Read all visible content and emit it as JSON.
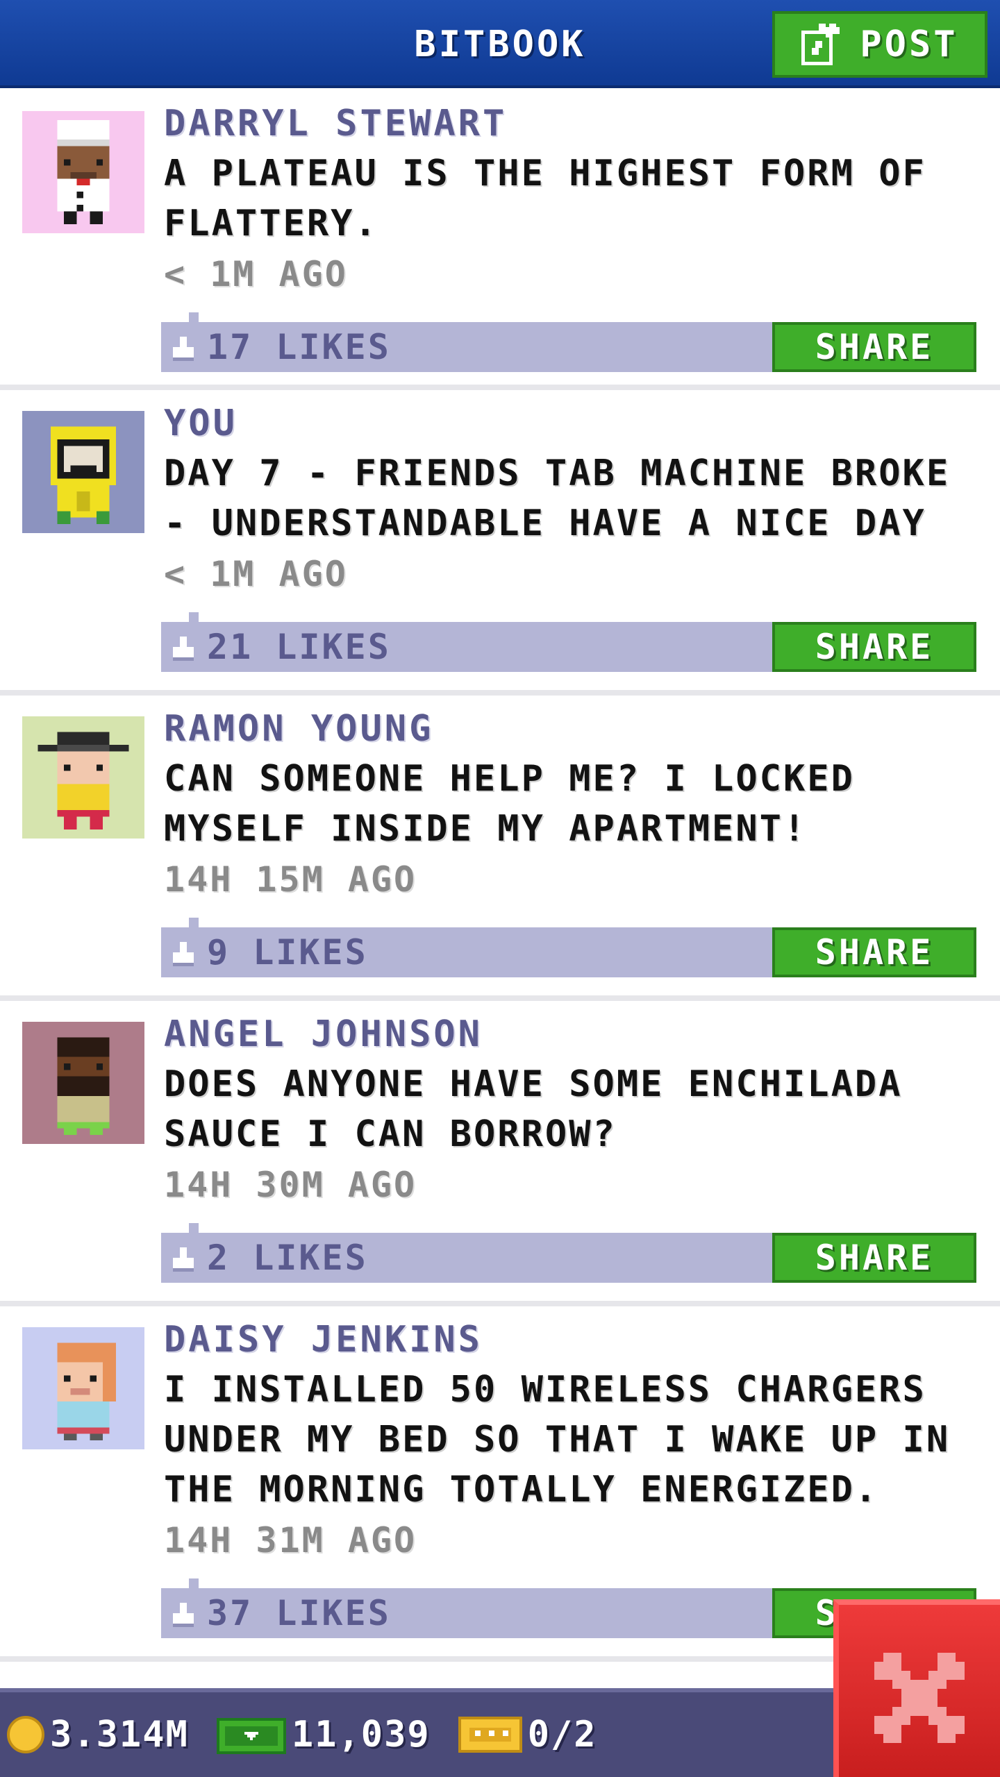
{
  "header": {
    "title": "BITBOOK",
    "post_label": "POST",
    "post_icon": "edit-icon"
  },
  "posts": [
    {
      "author": "DARRYL STEWART",
      "message": "A PLATEAU IS THE HIGHEST FORM OF FLATTERY.",
      "time": "< 1M AGO",
      "likes": "17 LIKES",
      "share_label": "SHARE",
      "avatar_bg": "#f8c8ef",
      "avatar": "chef-avatar"
    },
    {
      "author": "YOU",
      "message": "DAY 7 - FRIENDS TAB MACHINE BROKE - UNDERSTANDABLE HAVE A NICE DAY",
      "time": "< 1M AGO",
      "likes": "21 LIKES",
      "share_label": "SHARE",
      "avatar_bg": "#8c93bf",
      "avatar": "hazmat-avatar"
    },
    {
      "author": "RAMON YOUNG",
      "message": "CAN SOMEONE HELP ME? I LOCKED MYSELF INSIDE MY APARTMENT!",
      "time": "14H 15M AGO",
      "likes": "9 LIKES",
      "share_label": "SHARE",
      "avatar_bg": "#d6e4ae",
      "avatar": "bowler-hat-avatar"
    },
    {
      "author": "ANGEL JOHNSON",
      "message": "DOES ANYONE HAVE SOME ENCHILADA SAUCE I CAN BORROW?",
      "time": "14H 30M AGO",
      "likes": "2 LIKES",
      "share_label": "SHARE",
      "avatar_bg": "#ae7c8a",
      "avatar": "bearded-avatar"
    },
    {
      "author": "DAISY JENKINS",
      "message": "I INSTALLED 50 WIRELESS CHARGERS UNDER MY BED SO THAT I WAKE UP IN THE MORNING TOTALLY ENERGIZED.",
      "time": "14H 31M AGO",
      "likes": "37 LIKES",
      "share_label": "SHARE",
      "avatar_bg": "#c8cdf2",
      "avatar": "redhead-avatar"
    }
  ],
  "status_bar": {
    "coins": "3.314M",
    "bux": "11,039",
    "tickets": "0/2"
  },
  "colors": {
    "header": "#1a4aa8",
    "accent_green": "#3fae2a",
    "likes_bar": "#b4b5d6",
    "author_text": "#5a5a8e",
    "close_red": "#e02a2a"
  },
  "close_icon": "close-icon"
}
